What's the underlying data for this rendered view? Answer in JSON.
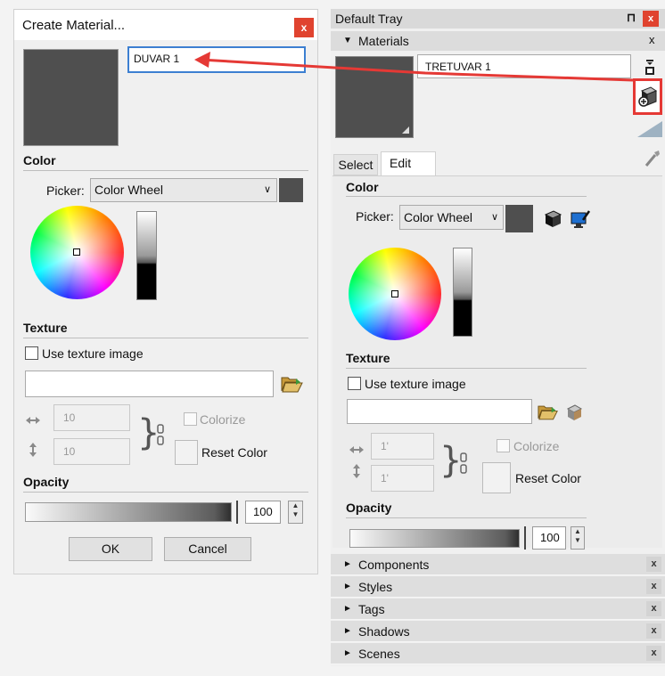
{
  "create_dialog": {
    "title": "Create Material...",
    "close_glyph": "x",
    "name_value": "DUVAR 1",
    "color_section": "Color",
    "picker_label": "Picker:",
    "picker_value": "Color Wheel",
    "texture_section": "Texture",
    "use_texture_label": "Use texture image",
    "width_value": "10",
    "height_value": "10",
    "colorize_label": "Colorize",
    "reset_color_label": "Reset Color",
    "opacity_section": "Opacity",
    "opacity_value": "100",
    "ok_label": "OK",
    "cancel_label": "Cancel"
  },
  "tray": {
    "title": "Default Tray",
    "pin_glyph": "⊓",
    "close_glyph": "x",
    "materials_panel": {
      "title": "Materials",
      "close_glyph": "x",
      "material_name": "TRETUVAR 1",
      "tabs": [
        "Select",
        "Edit"
      ],
      "active_tab": "Edit",
      "color_section": "Color",
      "picker_label": "Picker:",
      "picker_value": "Color Wheel",
      "texture_section": "Texture",
      "use_texture_label": "Use texture image",
      "width_value": "1'",
      "height_value": "1'",
      "colorize_label": "Colorize",
      "reset_color_label": "Reset Color",
      "opacity_section": "Opacity",
      "opacity_value": "100"
    },
    "collapsed_panels": [
      {
        "label": "Components"
      },
      {
        "label": "Styles"
      },
      {
        "label": "Tags"
      },
      {
        "label": "Shadows"
      },
      {
        "label": "Scenes"
      }
    ],
    "row_close_glyph": "x"
  },
  "colors": {
    "dialog_close": "#e0432f",
    "highlight_red": "#e53935",
    "swatch": "#4f4f4f",
    "tray_header": "#d9d9d9"
  }
}
